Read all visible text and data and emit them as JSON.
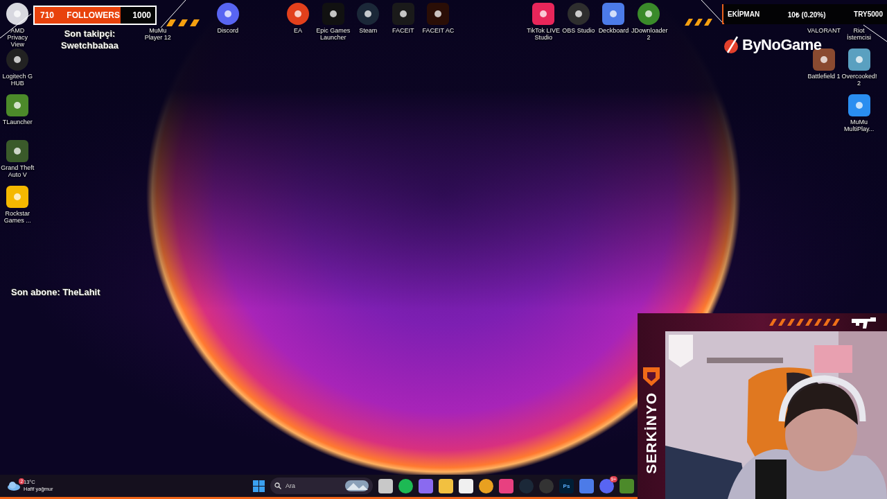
{
  "overlay": {
    "followers": {
      "current": "710",
      "label": "FOLLOWERS",
      "goal": "1000",
      "level": 0.71
    },
    "last_follower": {
      "label": "Son takipçi:",
      "name": "Swetchbabaa"
    },
    "last_subscriber": "Son abone: TheLahit",
    "donation_goal": {
      "title": "EKİPMAN",
      "progress": "10₺ (0.20%)",
      "goal": "TRY5000",
      "level": 0.002
    },
    "sponsor": "ByNoGame",
    "streamer": "SERKİNYO"
  },
  "desktop_icons": [
    {
      "label": "AMD Privacy View"
    },
    {
      "label": "MuMu Player 12"
    },
    {
      "label": "Discord"
    },
    {
      "label": "EA"
    },
    {
      "label": "Epic Games Launcher"
    },
    {
      "label": "Steam"
    },
    {
      "label": "FACEIT"
    },
    {
      "label": "FACEIT AC"
    },
    {
      "label": "TikTok LIVE Studio"
    },
    {
      "label": "OBS Studio"
    },
    {
      "label": "Deckboard"
    },
    {
      "label": "JDownloader 2"
    },
    {
      "label": "VALORANT"
    },
    {
      "label": "Riot İstemcisi"
    },
    {
      "label": "Logitech G HUB"
    },
    {
      "label": "Battlefield 1"
    },
    {
      "label": "Overcooked! 2"
    },
    {
      "label": "TLauncher"
    },
    {
      "label": "MuMu MultiPlay..."
    },
    {
      "label": "Grand Theft Auto V"
    },
    {
      "label": "Rockstar Games ..."
    }
  ],
  "taskbar": {
    "weather": {
      "badge": "2",
      "temperature": "13°C",
      "condition": "Hafif yağmur"
    },
    "search": {
      "placeholder": "Ara"
    },
    "app_glyph": "Ps",
    "notification_badge": "9+"
  }
}
